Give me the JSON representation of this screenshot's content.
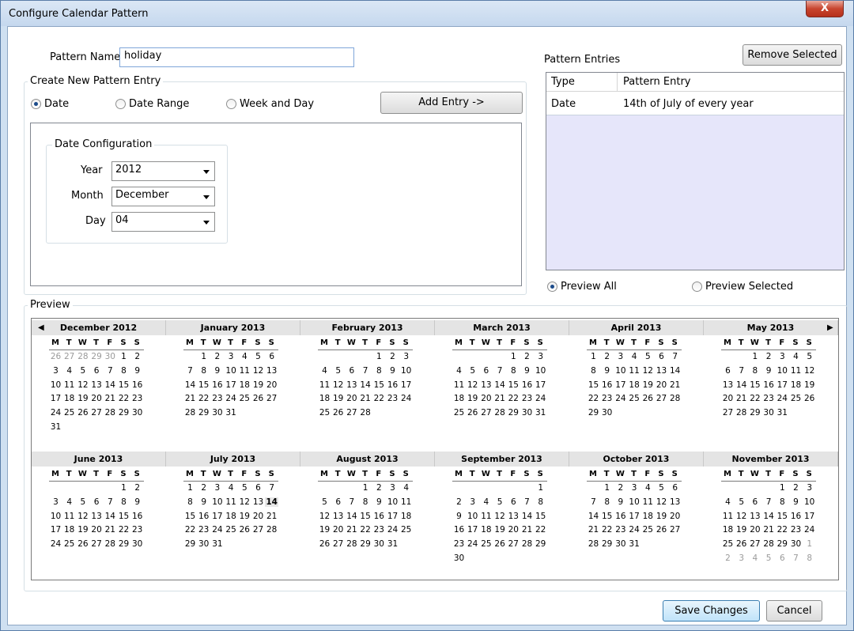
{
  "window": {
    "title": "Configure Calendar Pattern",
    "close_label": "X"
  },
  "pattern_name": {
    "label": "Pattern Name",
    "value": "holiday"
  },
  "create_entry": {
    "group_label": "Create New Pattern Entry",
    "radios": [
      {
        "label": "Date",
        "selected": true
      },
      {
        "label": "Date Range",
        "selected": false
      },
      {
        "label": "Week and Day",
        "selected": false
      }
    ],
    "add_button": "Add Entry ->",
    "date_config": {
      "group_label": "Date Configuration",
      "year": {
        "label": "Year",
        "value": "2012"
      },
      "month": {
        "label": "Month",
        "value": "December"
      },
      "day": {
        "label": "Day",
        "value": "04"
      }
    }
  },
  "pattern_entries": {
    "label": "Pattern Entries",
    "remove_button": "Remove Selected",
    "columns": [
      "Type",
      "Pattern Entry"
    ],
    "rows": [
      {
        "type": "Date",
        "entry": "14th of July of every year"
      }
    ]
  },
  "preview_options": [
    {
      "label": "Preview All",
      "selected": true
    },
    {
      "label": "Preview Selected",
      "selected": false
    }
  ],
  "preview": {
    "label": "Preview",
    "weekdays": [
      "M",
      "T",
      "W",
      "T",
      "F",
      "S",
      "S"
    ],
    "months": [
      {
        "name": "December 2012",
        "lead": [
          26,
          27,
          28,
          29,
          30
        ],
        "days": 31,
        "trail": []
      },
      {
        "name": "January 2013",
        "lead": [],
        "days": 31,
        "trail": []
      },
      {
        "name": "February 2013",
        "lead": [],
        "days": 28,
        "trail": []
      },
      {
        "name": "March 2013",
        "lead": [],
        "days": 31,
        "trail": []
      },
      {
        "name": "April 2013",
        "lead": [],
        "days": 30,
        "trail": []
      },
      {
        "name": "May 2013",
        "lead": [],
        "days": 31,
        "trail": []
      },
      {
        "name": "June 2013",
        "lead": [],
        "days": 30,
        "trail": []
      },
      {
        "name": "July 2013",
        "lead": [],
        "days": 31,
        "trail": [],
        "highlight": 14
      },
      {
        "name": "August 2013",
        "lead": [],
        "days": 31,
        "trail": []
      },
      {
        "name": "September 2013",
        "lead": [],
        "days": 30,
        "trail": []
      },
      {
        "name": "October 2013",
        "lead": [],
        "days": 31,
        "trail": []
      },
      {
        "name": "November 2013",
        "lead": [],
        "days": 30,
        "trail": [
          1,
          2,
          3,
          4,
          5,
          6,
          7,
          8
        ]
      }
    ],
    "start_offsets": [
      5,
      1,
      4,
      4,
      0,
      2,
      5,
      0,
      3,
      6,
      1,
      4
    ]
  },
  "footer": {
    "save": "Save Changes",
    "cancel": "Cancel"
  }
}
